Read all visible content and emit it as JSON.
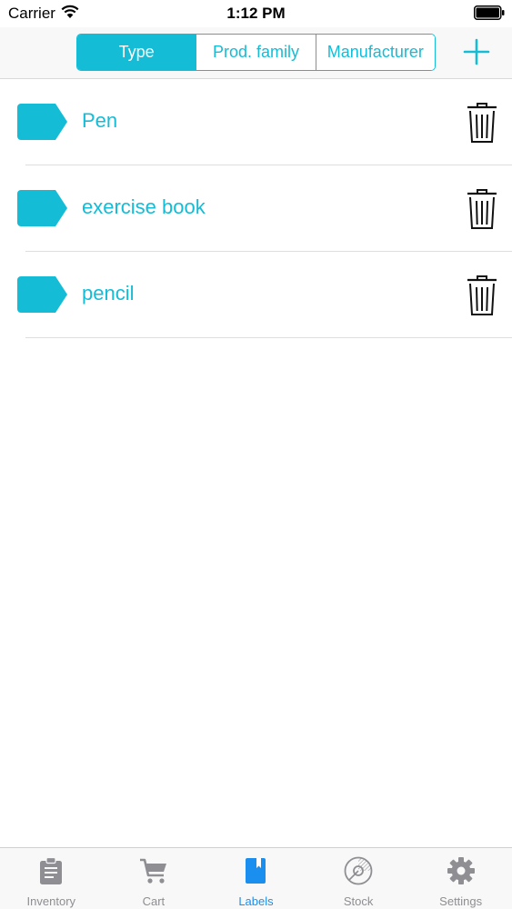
{
  "status_bar": {
    "carrier": "Carrier",
    "time": "1:12 PM"
  },
  "nav": {
    "segments": [
      {
        "label": "Type",
        "selected": true
      },
      {
        "label": "Prod. family",
        "selected": false
      },
      {
        "label": "Manufacturer",
        "selected": false
      }
    ],
    "add_icon": "plus-icon"
  },
  "labels": [
    {
      "name": "Pen",
      "icon": "tag-icon",
      "action_icon": "trash-icon"
    },
    {
      "name": "exercise book",
      "icon": "tag-icon",
      "action_icon": "trash-icon"
    },
    {
      "name": "pencil",
      "icon": "tag-icon",
      "action_icon": "trash-icon"
    }
  ],
  "tab_bar": {
    "tabs": [
      {
        "label": "Inventory",
        "icon": "clipboard-icon",
        "selected": false
      },
      {
        "label": "Cart",
        "icon": "cart-icon",
        "selected": false
      },
      {
        "label": "Labels",
        "icon": "book-icon",
        "selected": true
      },
      {
        "label": "Stock",
        "icon": "pie-chart-icon",
        "selected": false
      },
      {
        "label": "Settings",
        "icon": "gear-icon",
        "selected": false
      }
    ]
  },
  "colors": {
    "accent": "#14bcd6",
    "tab_active": "#1a8ff0",
    "tab_inactive": "#8e8e93"
  }
}
